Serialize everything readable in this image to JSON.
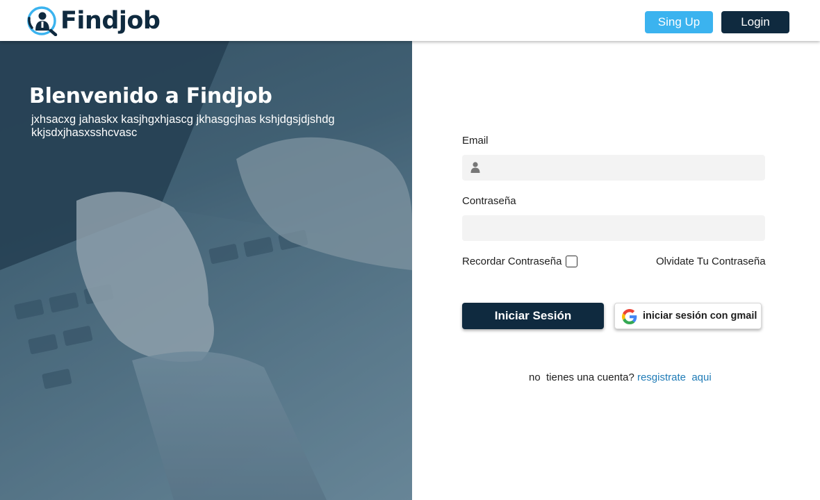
{
  "header": {
    "brand": "Findjob",
    "signup_label": "Sing Up",
    "login_label": "Login"
  },
  "hero": {
    "title": "Blenvenido a Findjob",
    "subtitle": "jxhsacxg jahaskx kasjhgxhjascg jkhasgcjhas kshjdgsjdjshdg kkjsdxjhasxsshcvasc"
  },
  "form": {
    "email_label": "Email",
    "email_value": "",
    "password_label": "Contraseña",
    "password_value": "",
    "remember_label": "Recordar Contraseña",
    "remember_checked": false,
    "forgot_label": "Olvidate Tu Contraseña",
    "submit_label": "Iniciar Sesión",
    "google_label": "iniciar sesión con gmail"
  },
  "signup_prompt": {
    "text": "no  tienes una cuenta? ",
    "link_text": "resgistrate  aqui"
  },
  "icons": [
    "findjob-logo-icon",
    "user-icon",
    "google-icon"
  ],
  "colors": {
    "brand_navy": "#0f2a3f",
    "signup_blue": "#3bb3ef",
    "link_blue": "#1f7bb6",
    "input_bg": "#f3f3f3"
  }
}
